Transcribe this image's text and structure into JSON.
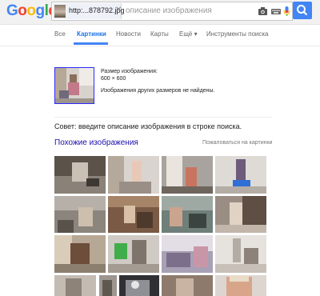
{
  "logo": {
    "letters": [
      "G",
      "o",
      "o",
      "g",
      "l",
      "e"
    ],
    "colors": [
      "#4285f4",
      "#ea4335",
      "#fbbc05",
      "#4285f4",
      "#34a853",
      "#ea4335"
    ]
  },
  "search": {
    "image_chip_label": "http:...878792.jpg",
    "placeholder": "описание изображения",
    "icons": [
      "camera-icon",
      "keyboard-icon",
      "microphone-icon",
      "search-icon"
    ]
  },
  "tabs": [
    {
      "label": "Все",
      "active": false
    },
    {
      "label": "Картинки",
      "active": true
    },
    {
      "label": "Новости",
      "active": false
    },
    {
      "label": "Карты",
      "active": false
    },
    {
      "label": "Ещё ▾",
      "active": false
    },
    {
      "label": "Инструменты поиска",
      "active": false
    }
  ],
  "image_info": {
    "size_label": "Размер изображения:",
    "size_value": "600 × 600",
    "no_other_sizes": "Изображения других размеров не найдены."
  },
  "tip": "Совет: введите описание изображения в строке поиска.",
  "similar": {
    "title": "Похожие изображения",
    "report_link": "Пожаловаться на картинки"
  },
  "colors": {
    "accent": "#4285f4",
    "link": "#1a0dab",
    "chrome_bg": "#f1f1f1"
  }
}
